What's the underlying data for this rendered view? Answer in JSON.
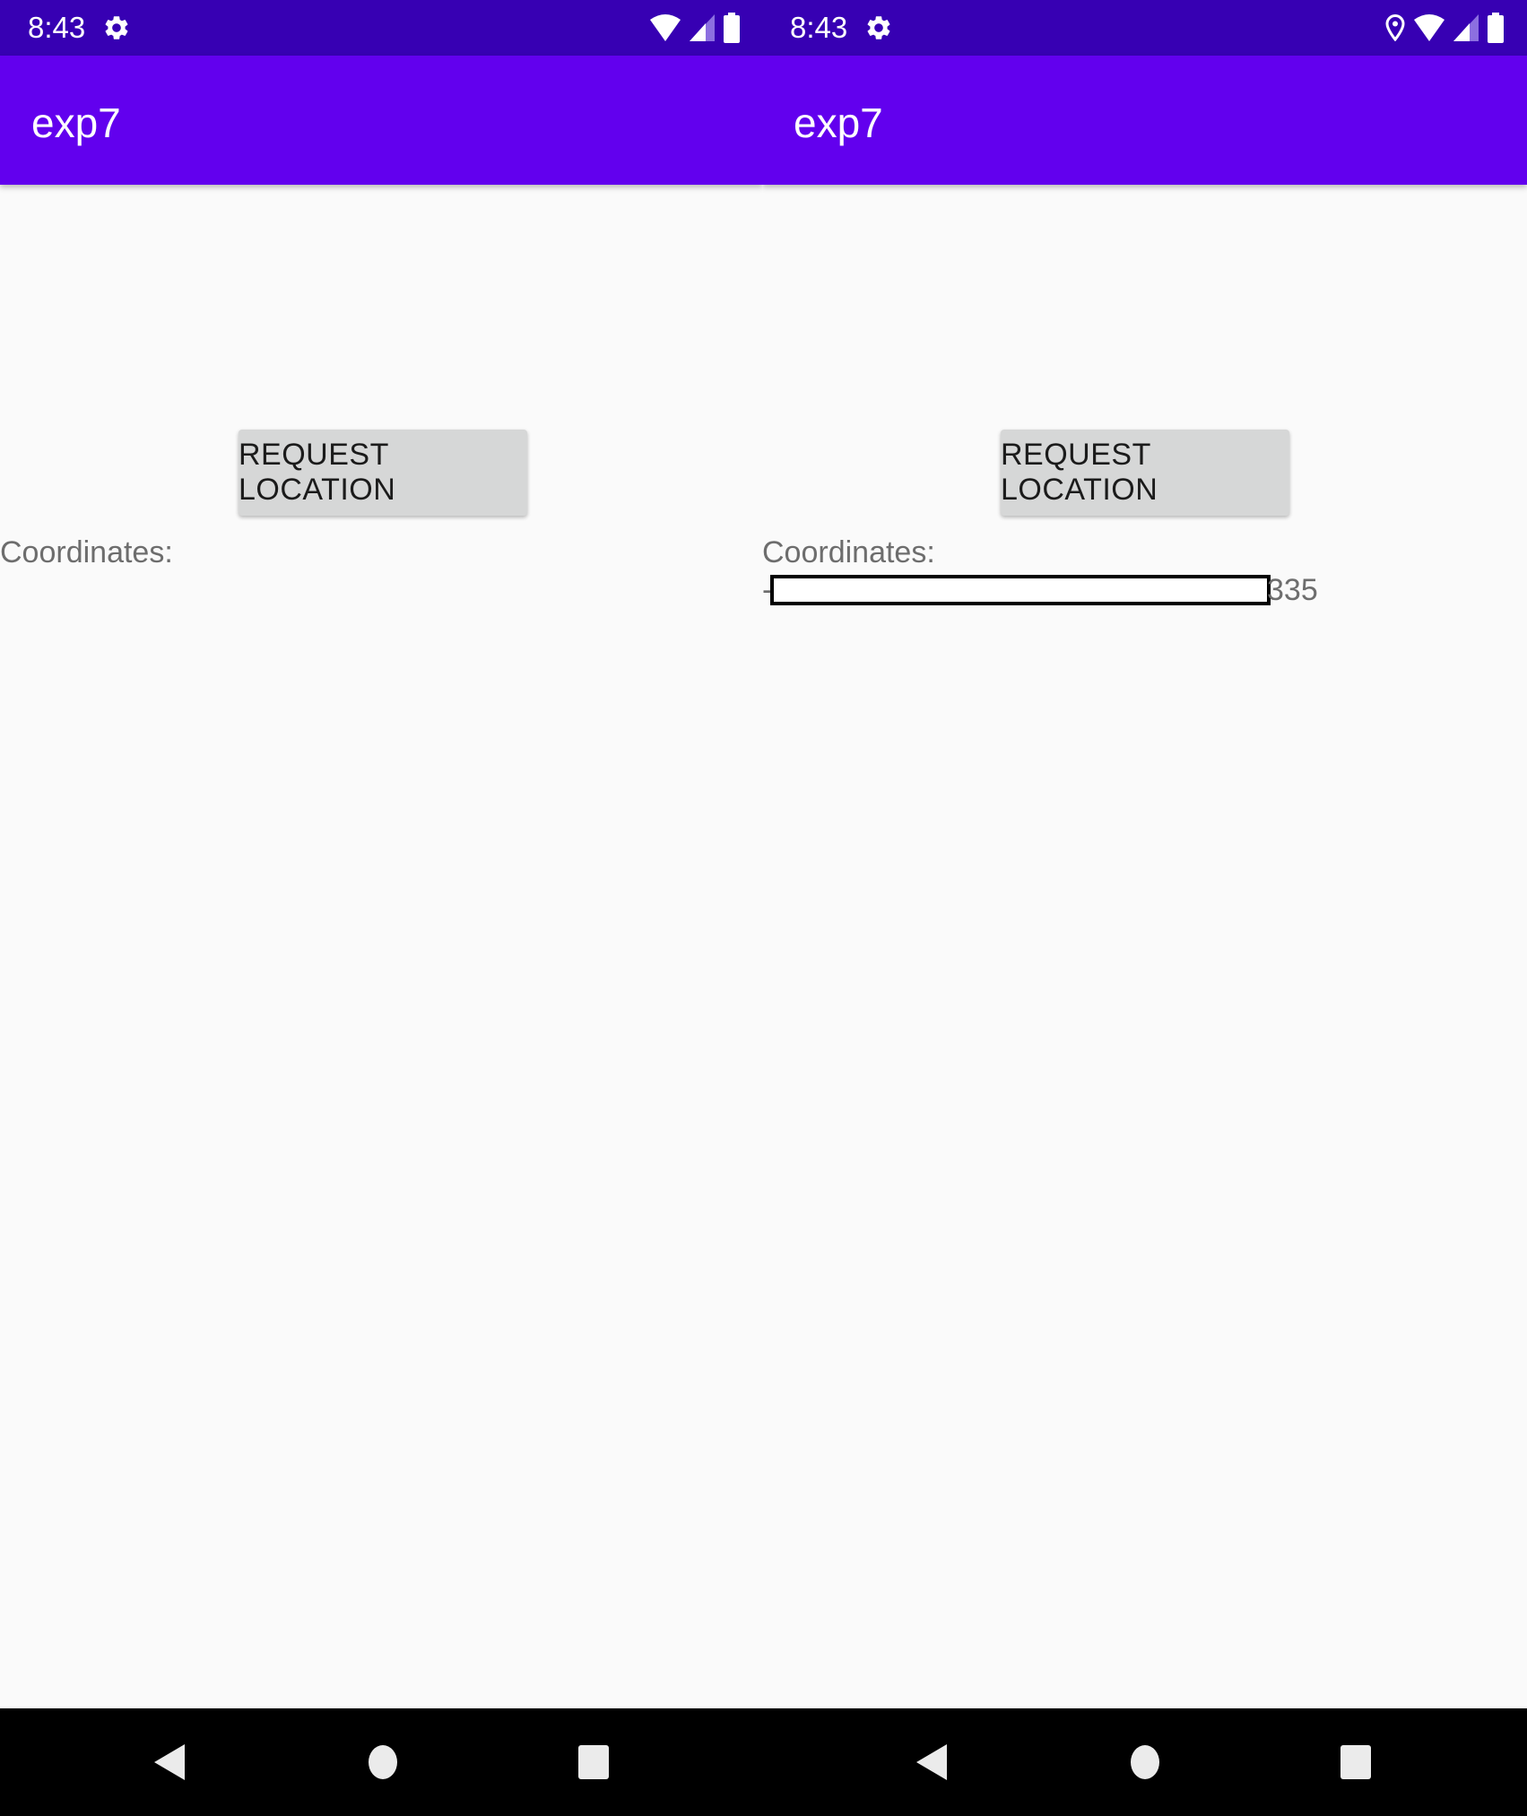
{
  "screens": [
    {
      "status_bar": {
        "time": "8:43",
        "icons": [
          "gear-icon",
          "wifi-icon",
          "signal-icon",
          "battery-icon"
        ]
      },
      "app_bar": {
        "title": "exp7"
      },
      "main": {
        "request_button_label": "REQUEST LOCATION",
        "coordinates_label": "Coordinates:"
      },
      "nav": [
        "back-icon",
        "home-icon",
        "recents-icon"
      ]
    },
    {
      "status_bar": {
        "time": "8:43",
        "icons": [
          "gear-icon",
          "location-icon",
          "wifi-icon",
          "signal-icon",
          "battery-icon"
        ]
      },
      "app_bar": {
        "title": "exp7"
      },
      "main": {
        "request_button_label": "REQUEST LOCATION",
        "coordinates_label": "Coordinates:",
        "coordinates_value_prefix": "-",
        "coordinates_value_suffix": "335"
      },
      "nav": [
        "back-icon",
        "home-icon",
        "recents-icon"
      ]
    }
  ],
  "colors": {
    "status_bar": "#3700b3",
    "app_bar": "#6200ee",
    "background": "#fafafa",
    "button": "#d6d7d7",
    "nav_bar": "#000000",
    "secondary_text": "#6d6d6d"
  }
}
